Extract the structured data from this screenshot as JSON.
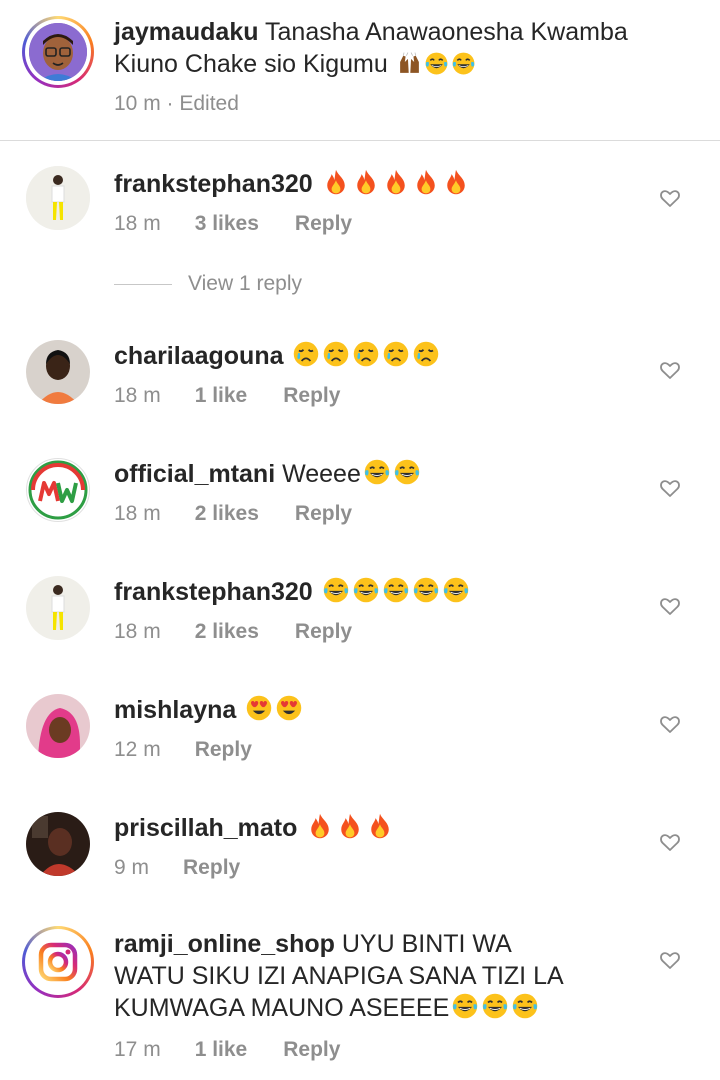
{
  "caption": {
    "username": "jaymaudaku",
    "text_line1": "Tanasha Anawaonesha Kwamba",
    "text_line2": "Kiuno Chake sio Kigumu",
    "time": "10 m",
    "edited": "· Edited"
  },
  "comments": [
    {
      "username": "frankstephan320",
      "time": "18 m",
      "likes": "3 likes",
      "reply": "Reply",
      "emoji": "fire",
      "count": 5
    },
    {
      "username": "charilaagouna",
      "time": "18 m",
      "likes": "1 like",
      "reply": "Reply",
      "emoji": "cry",
      "count": 5
    },
    {
      "username": "official_mtani",
      "text": "Weeee",
      "time": "18 m",
      "likes": "2 likes",
      "reply": "Reply",
      "emoji": "joy",
      "count": 2
    },
    {
      "username": "frankstephan320",
      "time": "18 m",
      "likes": "2 likes",
      "reply": "Reply",
      "emoji": "joy",
      "count": 5
    },
    {
      "username": "mishlayna",
      "time": "12 m",
      "reply": "Reply",
      "emoji": "hearteyes",
      "count": 2
    },
    {
      "username": "priscillah_mato",
      "time": "9 m",
      "reply": "Reply",
      "emoji": "fire",
      "count": 3
    },
    {
      "username": "ramji_online_shop",
      "text_line1": "UYU BINTI WA",
      "text_line2": "WATU SIKU IZI ANAPIGA SANA TIZI LA",
      "text_line3": "KUMWAGA MAUNO ASEEEE",
      "time": "17 m",
      "likes": "1 like",
      "reply": "Reply",
      "emoji": "joy",
      "count": 3
    }
  ],
  "view_replies": "View 1 reply",
  "colors": {
    "text": "#262626",
    "muted": "#8e8e8e",
    "divider": "#dbdbdb"
  }
}
